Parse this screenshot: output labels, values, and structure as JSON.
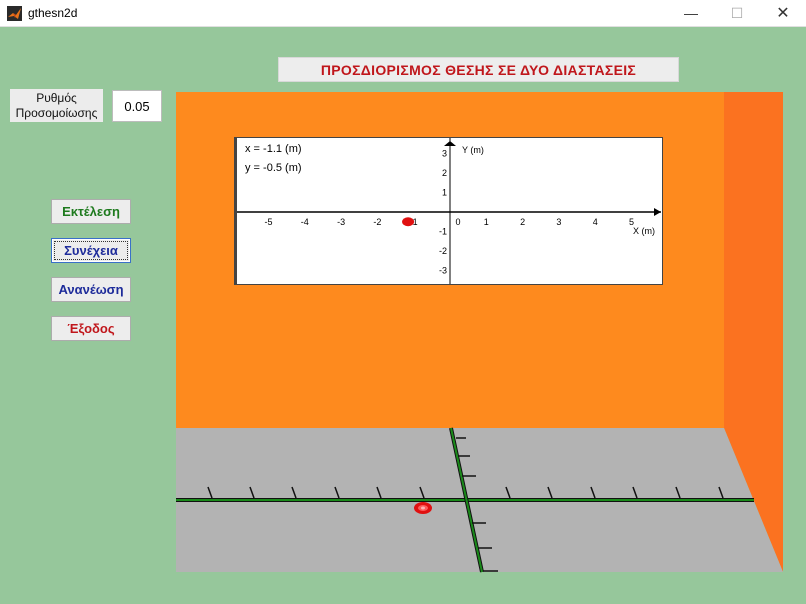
{
  "window": {
    "title": "gthesn2d",
    "minimize_glyph": "—",
    "maximize_glyph": "☐",
    "close_glyph": "✕"
  },
  "heading": "ΠΡΟΣΔΙΟΡΙΣΜΟΣ ΘΕΣΗΣ ΣΕ ΔΥΟ ΔΙΑΣΤΑΣΕΙΣ",
  "rate": {
    "label_line1": "Ρυθμός",
    "label_line2": "Προσομοίωσης",
    "value": "0.05"
  },
  "buttons": {
    "run": "Εκτέλεση",
    "continue": "Συνέχεια",
    "refresh": "Ανανέωση",
    "exit": "Έξοδος"
  },
  "plot": {
    "x_readout": "x = -1.1  (m)",
    "y_readout": "y = -0.5  (m)",
    "x_axis_label": "X (m)",
    "y_axis_label": "Y (m)",
    "x_ticks": [
      "-5",
      "-4",
      "-3",
      "-2",
      "-1",
      "0",
      "1",
      "2",
      "3",
      "4",
      "5"
    ],
    "y_ticks_pos": [
      "3",
      "2",
      "1"
    ],
    "y_ticks_neg": [
      "-1",
      "-2",
      "-3"
    ],
    "ball": {
      "x": -1.1,
      "y": -0.5
    }
  },
  "colors": {
    "background": "#96c79b",
    "wall_back": "#fe8a1e",
    "wall_side": "#fb7220",
    "floor": "#b3b3b3",
    "axis_line": "#1a8a1a",
    "ball": "#e01010",
    "button_run": "#1e7a1e",
    "button_continue": "#1d2b9a",
    "button_refresh": "#1d2b9a",
    "button_exit": "#c0161b"
  }
}
